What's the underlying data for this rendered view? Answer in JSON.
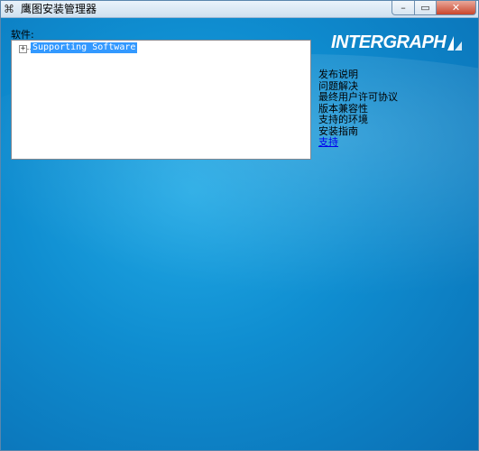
{
  "window": {
    "title": "鹰图安装管理器",
    "controls": {
      "minimize": "–",
      "maximize": "▭",
      "close": "✕"
    }
  },
  "software_panel": {
    "label": "软件:",
    "tree": [
      {
        "toggle": "+",
        "label": "Supporting Software",
        "selected": true
      }
    ]
  },
  "brand": {
    "logo_text": "INTERGRAPH",
    "logo_icon": "intergraph-logo-icon"
  },
  "links": [
    {
      "label": "发布说明"
    },
    {
      "label": "问题解决"
    },
    {
      "label": "最终用户许可协议"
    },
    {
      "label": "版本兼容性"
    },
    {
      "label": "支持的环境"
    },
    {
      "label": "安装指南"
    },
    {
      "label": "支持",
      "highlighted": true
    }
  ],
  "colors": {
    "background": "#0f8dd0",
    "selection": "#3399ff",
    "link": "#0000ee"
  }
}
